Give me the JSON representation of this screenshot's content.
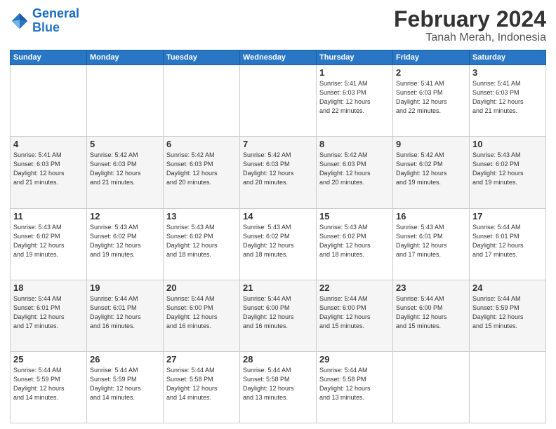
{
  "header": {
    "logo_line1": "General",
    "logo_line2": "Blue",
    "main_title": "February 2024",
    "sub_title": "Tanah Merah, Indonesia"
  },
  "days_of_week": [
    "Sunday",
    "Monday",
    "Tuesday",
    "Wednesday",
    "Thursday",
    "Friday",
    "Saturday"
  ],
  "weeks": [
    [
      {
        "day": "",
        "info": ""
      },
      {
        "day": "",
        "info": ""
      },
      {
        "day": "",
        "info": ""
      },
      {
        "day": "",
        "info": ""
      },
      {
        "day": "1",
        "info": "Sunrise: 5:41 AM\nSunset: 6:03 PM\nDaylight: 12 hours\nand 22 minutes."
      },
      {
        "day": "2",
        "info": "Sunrise: 5:41 AM\nSunset: 6:03 PM\nDaylight: 12 hours\nand 22 minutes."
      },
      {
        "day": "3",
        "info": "Sunrise: 5:41 AM\nSunset: 6:03 PM\nDaylight: 12 hours\nand 21 minutes."
      }
    ],
    [
      {
        "day": "4",
        "info": "Sunrise: 5:41 AM\nSunset: 6:03 PM\nDaylight: 12 hours\nand 21 minutes."
      },
      {
        "day": "5",
        "info": "Sunrise: 5:42 AM\nSunset: 6:03 PM\nDaylight: 12 hours\nand 21 minutes."
      },
      {
        "day": "6",
        "info": "Sunrise: 5:42 AM\nSunset: 6:03 PM\nDaylight: 12 hours\nand 20 minutes."
      },
      {
        "day": "7",
        "info": "Sunrise: 5:42 AM\nSunset: 6:03 PM\nDaylight: 12 hours\nand 20 minutes."
      },
      {
        "day": "8",
        "info": "Sunrise: 5:42 AM\nSunset: 6:03 PM\nDaylight: 12 hours\nand 20 minutes."
      },
      {
        "day": "9",
        "info": "Sunrise: 5:42 AM\nSunset: 6:02 PM\nDaylight: 12 hours\nand 19 minutes."
      },
      {
        "day": "10",
        "info": "Sunrise: 5:43 AM\nSunset: 6:02 PM\nDaylight: 12 hours\nand 19 minutes."
      }
    ],
    [
      {
        "day": "11",
        "info": "Sunrise: 5:43 AM\nSunset: 6:02 PM\nDaylight: 12 hours\nand 19 minutes."
      },
      {
        "day": "12",
        "info": "Sunrise: 5:43 AM\nSunset: 6:02 PM\nDaylight: 12 hours\nand 19 minutes."
      },
      {
        "day": "13",
        "info": "Sunrise: 5:43 AM\nSunset: 6:02 PM\nDaylight: 12 hours\nand 18 minutes."
      },
      {
        "day": "14",
        "info": "Sunrise: 5:43 AM\nSunset: 6:02 PM\nDaylight: 12 hours\nand 18 minutes."
      },
      {
        "day": "15",
        "info": "Sunrise: 5:43 AM\nSunset: 6:02 PM\nDaylight: 12 hours\nand 18 minutes."
      },
      {
        "day": "16",
        "info": "Sunrise: 5:43 AM\nSunset: 6:01 PM\nDaylight: 12 hours\nand 17 minutes."
      },
      {
        "day": "17",
        "info": "Sunrise: 5:44 AM\nSunset: 6:01 PM\nDaylight: 12 hours\nand 17 minutes."
      }
    ],
    [
      {
        "day": "18",
        "info": "Sunrise: 5:44 AM\nSunset: 6:01 PM\nDaylight: 12 hours\nand 17 minutes."
      },
      {
        "day": "19",
        "info": "Sunrise: 5:44 AM\nSunset: 6:01 PM\nDaylight: 12 hours\nand 16 minutes."
      },
      {
        "day": "20",
        "info": "Sunrise: 5:44 AM\nSunset: 6:00 PM\nDaylight: 12 hours\nand 16 minutes."
      },
      {
        "day": "21",
        "info": "Sunrise: 5:44 AM\nSunset: 6:00 PM\nDaylight: 12 hours\nand 16 minutes."
      },
      {
        "day": "22",
        "info": "Sunrise: 5:44 AM\nSunset: 6:00 PM\nDaylight: 12 hours\nand 15 minutes."
      },
      {
        "day": "23",
        "info": "Sunrise: 5:44 AM\nSunset: 6:00 PM\nDaylight: 12 hours\nand 15 minutes."
      },
      {
        "day": "24",
        "info": "Sunrise: 5:44 AM\nSunset: 5:59 PM\nDaylight: 12 hours\nand 15 minutes."
      }
    ],
    [
      {
        "day": "25",
        "info": "Sunrise: 5:44 AM\nSunset: 5:59 PM\nDaylight: 12 hours\nand 14 minutes."
      },
      {
        "day": "26",
        "info": "Sunrise: 5:44 AM\nSunset: 5:59 PM\nDaylight: 12 hours\nand 14 minutes."
      },
      {
        "day": "27",
        "info": "Sunrise: 5:44 AM\nSunset: 5:58 PM\nDaylight: 12 hours\nand 14 minutes."
      },
      {
        "day": "28",
        "info": "Sunrise: 5:44 AM\nSunset: 5:58 PM\nDaylight: 12 hours\nand 13 minutes."
      },
      {
        "day": "29",
        "info": "Sunrise: 5:44 AM\nSunset: 5:58 PM\nDaylight: 12 hours\nand 13 minutes."
      },
      {
        "day": "",
        "info": ""
      },
      {
        "day": "",
        "info": ""
      }
    ]
  ]
}
